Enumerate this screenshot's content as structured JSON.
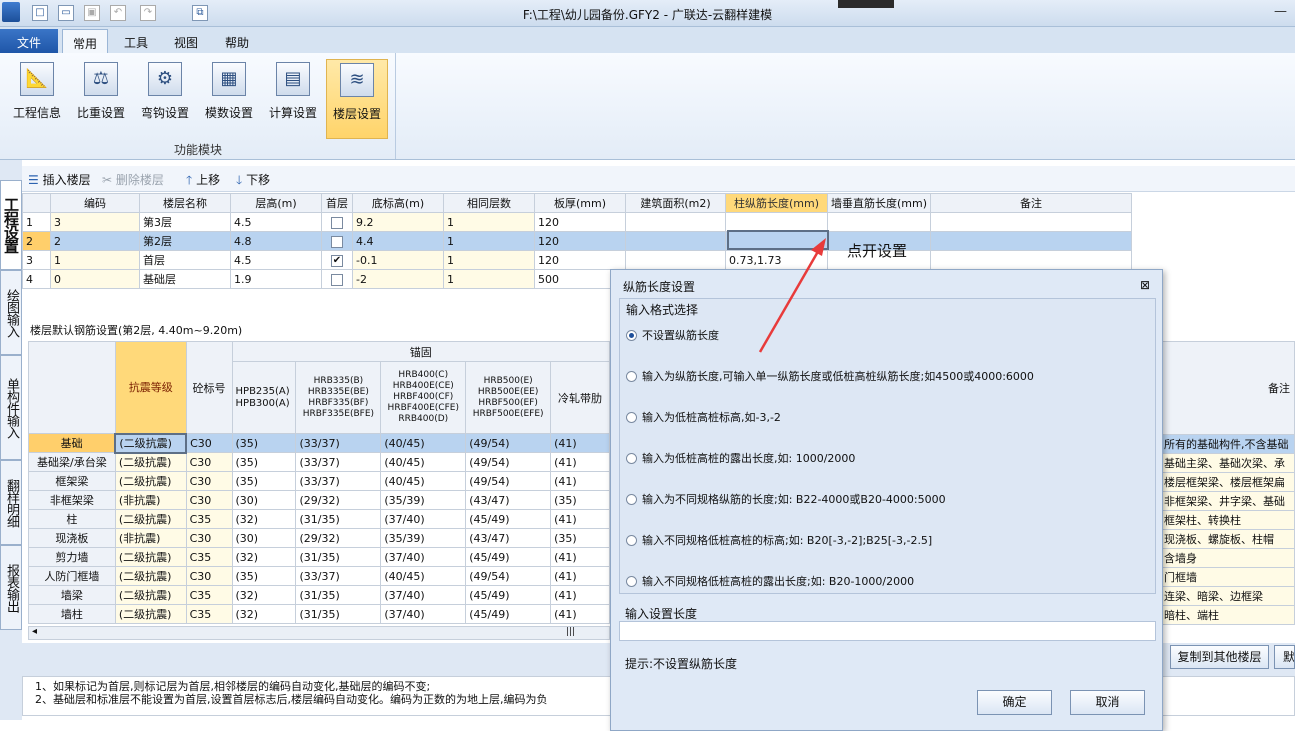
{
  "window": {
    "title": "F:\\工程\\幼儿园备份.GFY2 - 广联达-云翻样建模"
  },
  "tabs": [
    "文件",
    "常用",
    "工具",
    "视图",
    "帮助"
  ],
  "ribbon": {
    "buttons": [
      {
        "label": "工程信息",
        "icon": "project-info-icon"
      },
      {
        "label": "比重设置",
        "icon": "scale-icon"
      },
      {
        "label": "弯钩设置",
        "icon": "hook-icon"
      },
      {
        "label": "模数设置",
        "icon": "modulus-icon"
      },
      {
        "label": "计算设置",
        "icon": "calc-icon"
      },
      {
        "label": "楼层设置",
        "icon": "floor-icon"
      }
    ],
    "group": "功能模块"
  },
  "side_tabs": [
    "工程设置",
    "绘图输入",
    "单构件输入",
    "翻样明细",
    "报表输出"
  ],
  "toolbar": {
    "insert": "插入楼层",
    "delete": "删除楼层",
    "up": "上移",
    "down": "下移"
  },
  "floor_table": {
    "headers": [
      "编码",
      "楼层名称",
      "层高(m)",
      "首层",
      "底标高(m)",
      "相同层数",
      "板厚(mm)",
      "建筑面积(m2)",
      "柱纵筋长度(mm)",
      "墙垂直筋长度(mm)",
      "备注"
    ],
    "rows": [
      {
        "no": "1",
        "code": "3",
        "name": "第3层",
        "height": "4.5",
        "first": false,
        "base": "9.2",
        "same": "1",
        "thick": "120",
        "area": "",
        "col": "",
        "wall": "",
        "note": ""
      },
      {
        "no": "2",
        "code": "2",
        "name": "第2层",
        "height": "4.8",
        "first": false,
        "base": "4.4",
        "same": "1",
        "thick": "120",
        "area": "",
        "col": "",
        "wall": "",
        "note": ""
      },
      {
        "no": "3",
        "code": "1",
        "name": "首层",
        "height": "4.5",
        "first": true,
        "base": "-0.1",
        "same": "1",
        "thick": "120",
        "area": "",
        "col": "0.73,1.73",
        "wall": "",
        "note": ""
      },
      {
        "no": "4",
        "code": "0",
        "name": "基础层",
        "height": "1.9",
        "first": false,
        "base": "-2",
        "same": "1",
        "thick": "500",
        "area": "",
        "col": "",
        "wall": "",
        "note": ""
      }
    ]
  },
  "callout": "点开设置",
  "rebar": {
    "title": "楼层默认钢筋设置(第2层, 4.40m~9.20m)",
    "group_header": "锚固",
    "headers": [
      "抗震等级",
      "砼标号",
      "HPB235(A)\nHPB300(A)",
      "HRB335(B)\nHRB335E(BE)\nHRBF335(BF)\nHRBF335E(BFE)",
      "HRB400(C)\nHRB400E(CE)\nHRBF400(CF)\nHRBF400E(CFE)\nRRB400(D)",
      "HRB500(E)\nHRB500E(EE)\nHRBF500(EF)\nHRBF500E(EFE)",
      "冷轧带肋"
    ],
    "right_header": "备注",
    "rows": [
      {
        "name": "基础",
        "seismic": "(二级抗震)",
        "grade": "C30",
        "a": "(35)",
        "b": "(33/37)",
        "c": "(40/45)",
        "e": "(49/54)",
        "cold": "(41)",
        "note": "所有的基础构件,不含基础"
      },
      {
        "name": "基础梁/承台梁",
        "seismic": "(二级抗震)",
        "grade": "C30",
        "a": "(35)",
        "b": "(33/37)",
        "c": "(40/45)",
        "e": "(49/54)",
        "cold": "(41)",
        "note": "基础主梁、基础次梁、承"
      },
      {
        "name": "框架梁",
        "seismic": "(二级抗震)",
        "grade": "C30",
        "a": "(35)",
        "b": "(33/37)",
        "c": "(40/45)",
        "e": "(49/54)",
        "cold": "(41)",
        "note": "楼层框架梁、楼层框架扁"
      },
      {
        "name": "非框架梁",
        "seismic": "(非抗震)",
        "grade": "C30",
        "a": "(30)",
        "b": "(29/32)",
        "c": "(35/39)",
        "e": "(43/47)",
        "cold": "(35)",
        "note": "非框架梁、井字梁、基础"
      },
      {
        "name": "柱",
        "seismic": "(二级抗震)",
        "grade": "C35",
        "a": "(32)",
        "b": "(31/35)",
        "c": "(37/40)",
        "e": "(45/49)",
        "cold": "(41)",
        "note": "框架柱、转换柱"
      },
      {
        "name": "现浇板",
        "seismic": "(非抗震)",
        "grade": "C30",
        "a": "(30)",
        "b": "(29/32)",
        "c": "(35/39)",
        "e": "(43/47)",
        "cold": "(35)",
        "note": "现浇板、螺旋板、柱帽"
      },
      {
        "name": "剪力墙",
        "seismic": "(二级抗震)",
        "grade": "C35",
        "a": "(32)",
        "b": "(31/35)",
        "c": "(37/40)",
        "e": "(45/49)",
        "cold": "(41)",
        "note": "含墙身"
      },
      {
        "name": "人防门框墙",
        "seismic": "(二级抗震)",
        "grade": "C30",
        "a": "(35)",
        "b": "(33/37)",
        "c": "(40/45)",
        "e": "(49/54)",
        "cold": "(41)",
        "note": "门框墙"
      },
      {
        "name": "墙梁",
        "seismic": "(二级抗震)",
        "grade": "C35",
        "a": "(32)",
        "b": "(31/35)",
        "c": "(37/40)",
        "e": "(45/49)",
        "cold": "(41)",
        "note": "连梁、暗梁、边框梁"
      },
      {
        "name": "墙柱",
        "seismic": "(二级抗震)",
        "grade": "C35",
        "a": "(32)",
        "b": "(31/35)",
        "c": "(37/40)",
        "e": "(45/49)",
        "cold": "(41)",
        "note": "暗柱、端柱"
      }
    ]
  },
  "copy_button": "复制到其他楼层",
  "copy_button2": "默",
  "notes": [
    "1、如果标记为首层,则标记层为首层,相邻楼层的编码自动变化,基础层的编码不变;",
    "2、基础层和标准层不能设置为首层,设置首层标志后,楼层编码自动变化。编码为正数的为地上层,编码为负"
  ],
  "dialog": {
    "title": "纵筋长度设置",
    "close": "⊠",
    "group1": "输入格式选择",
    "options": [
      "不设置纵筋长度",
      "输入为纵筋长度,可输入单一纵筋长度或低桩高桩纵筋长度;如4500或4000:6000",
      "输入为低桩高桩标高,如-3,-2",
      "输入为低桩高桩的露出长度,如: 1000/2000",
      "输入为不同规格纵筋的长度;如: B22-4000或B20-4000:5000",
      "输入不同规格低桩高桩的标高;如: B20[-3,-2];B25[-3,-2.5]",
      "输入不同规格低桩高桩的露出长度;如: B20-1000/2000"
    ],
    "selected": 0,
    "group2": "输入设置长度",
    "input_value": "",
    "hint": "提示:不设置纵筋长度",
    "ok": "确定",
    "cancel": "取消"
  },
  "colors": {
    "accent": "#1f56a8",
    "selected_row": "#b9d3f0",
    "highlight_header": "#ffd97a",
    "arrow": "#e83b3b"
  }
}
